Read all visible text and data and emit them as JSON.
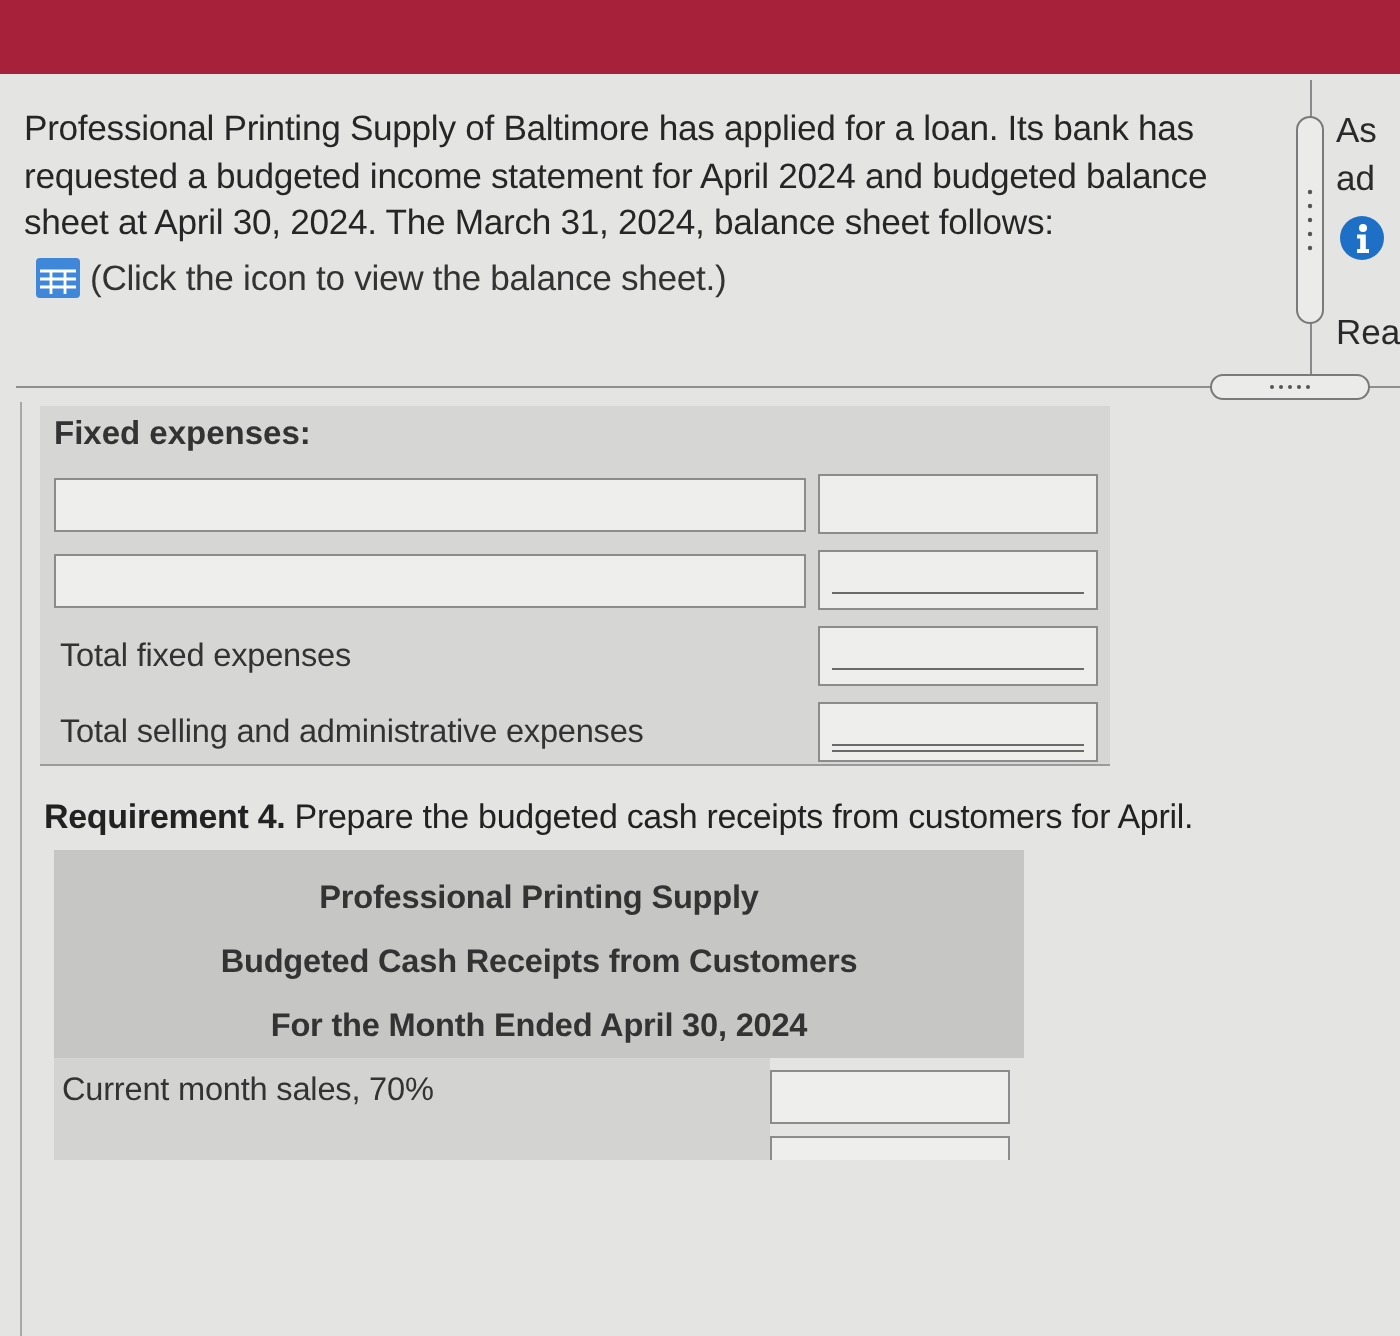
{
  "problem": {
    "text": "Professional Printing Supply of Baltimore has applied for a loan. Its bank has requested a budgeted income statement for April 2024 and budgeted balance sheet at April 30, 2024. The March 31, 2024, balance sheet follows:",
    "hint": "(Click the icon to view the balance sheet.)"
  },
  "side_panel": {
    "items": [
      {
        "kind": "text",
        "text": "As"
      },
      {
        "kind": "text",
        "text": "ad"
      },
      {
        "kind": "info"
      },
      {
        "kind": "text",
        "text": "Rea"
      }
    ]
  },
  "fixed_expenses": {
    "heading": "Fixed expenses:",
    "rows": [
      {
        "kind": "entry",
        "underlined": false,
        "double_underlined": false
      },
      {
        "kind": "entry",
        "underlined": true,
        "double_underlined": false
      },
      {
        "kind": "total",
        "label": "Total fixed expenses",
        "underlined": true,
        "double_underlined": false
      },
      {
        "kind": "total",
        "label": "Total selling and administrative expenses",
        "underlined": true,
        "double_underlined": true
      }
    ]
  },
  "requirement": {
    "text": "**Requirement 4.** Prepare the budgeted cash receipts from customers for April."
  },
  "cash_receipts": {
    "title_lines": [
      "Professional Printing Supply",
      "Budgeted Cash Receipts from Customers",
      "For the Month Ended April 30, 2024"
    ],
    "rows": [
      {
        "label": "Current month sales, 70%",
        "cut_off": false
      },
      {
        "cut_off": true
      }
    ]
  }
}
